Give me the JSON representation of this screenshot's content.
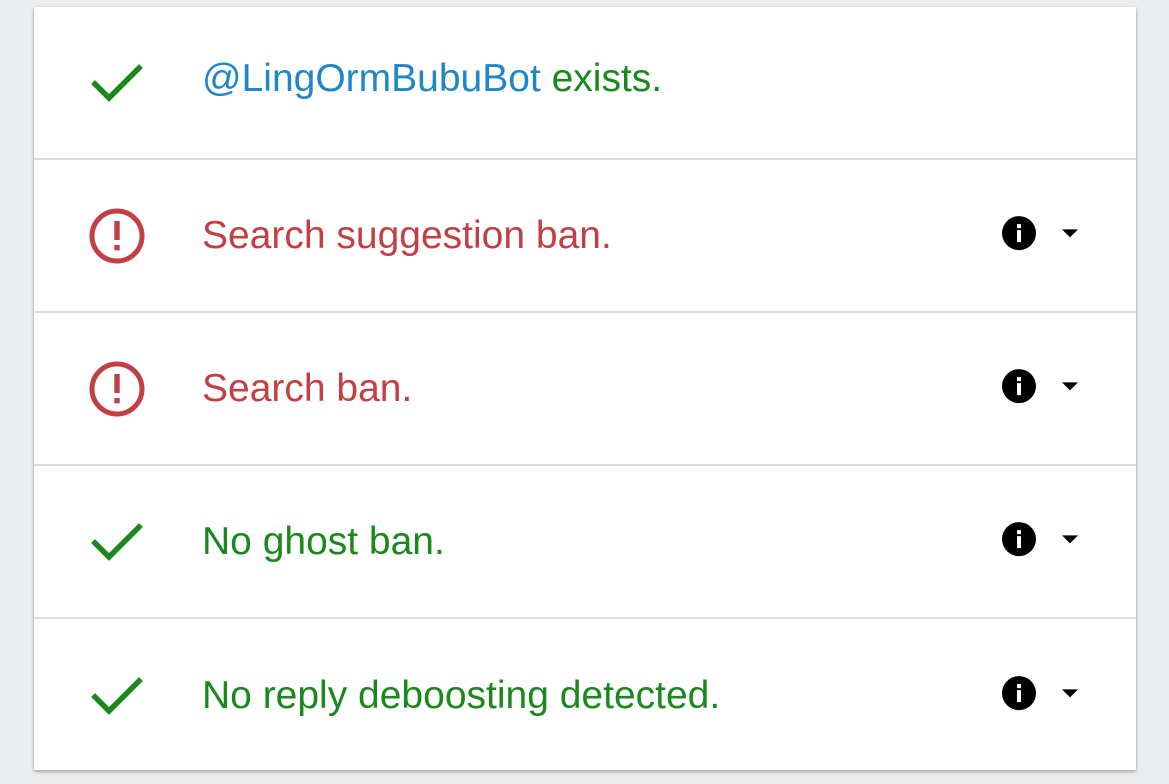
{
  "rows": [
    {
      "status": "ok",
      "status_icon": "check-icon",
      "handle": "@LingOrmBubuBot",
      "text": " exists.",
      "has_info": false
    },
    {
      "status": "bad",
      "status_icon": "alert-circle-icon",
      "text": "Search suggestion ban.",
      "has_info": true
    },
    {
      "status": "bad",
      "status_icon": "alert-circle-icon",
      "text": "Search ban.",
      "has_info": true
    },
    {
      "status": "ok",
      "status_icon": "check-icon",
      "text": "No ghost ban.",
      "has_info": true
    },
    {
      "status": "ok",
      "status_icon": "check-icon",
      "text": "No reply deboosting detected.",
      "has_info": true
    }
  ],
  "colors": {
    "ok": "#19881d",
    "bad": "#c24043",
    "handle": "#1f86c8"
  }
}
